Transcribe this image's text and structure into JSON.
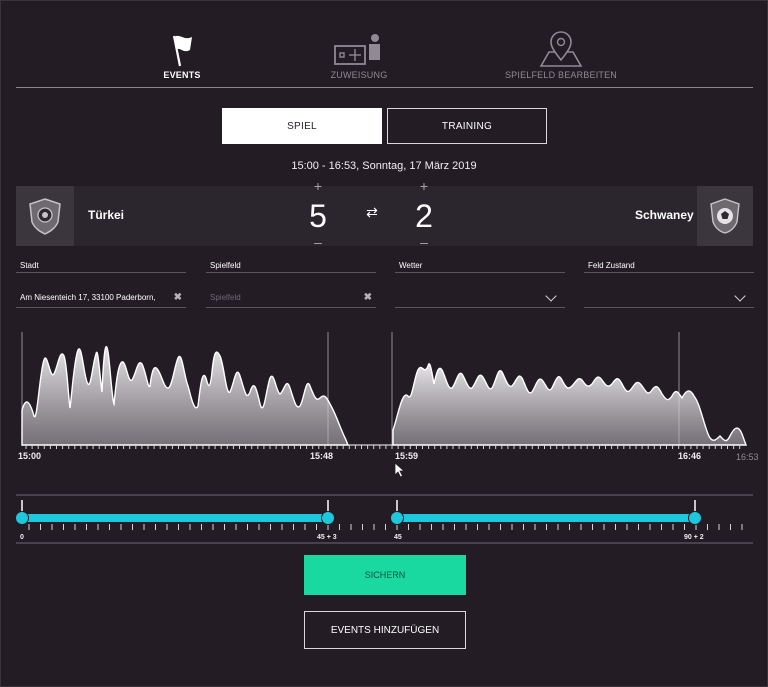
{
  "nav": [
    {
      "label": "EVENTS",
      "icon": "flag-icon",
      "active": true
    },
    {
      "label": "ZUWEISUNG",
      "icon": "assignment-icon",
      "active": false
    },
    {
      "label": "SPIELFELD BEARBEITEN",
      "icon": "map-pin-icon",
      "active": false
    }
  ],
  "toggle": {
    "spiel": "SPIEL",
    "training": "TRAINING",
    "selected": "SPIEL"
  },
  "datetime": "15:00 - 16:53, Sonntag, 17 März 2019",
  "score": {
    "home_team": "Türkei",
    "away_team": "Schwaney",
    "home_score": "5",
    "away_score": "2",
    "plus": "+",
    "minus": "–",
    "swap": "⇄"
  },
  "fields": {
    "stadt": {
      "label": "Stadt",
      "value": "Am Niesenteich 17, 33100 Paderborn,"
    },
    "spielfeld": {
      "label": "Spielfeld",
      "placeholder": "Spielfeld"
    },
    "wetter": {
      "label": "Wetter",
      "value": ""
    },
    "feld_zustand": {
      "label": "Feld Zustand",
      "value": ""
    }
  },
  "timeline": {
    "first_half": {
      "start": "15:00",
      "end": "15:48"
    },
    "second_half": {
      "start": "15:59",
      "end": "16:46"
    },
    "match_end": "16:53"
  },
  "sliders": {
    "first_half": {
      "min_label": "0",
      "max_label": "45 + 3"
    },
    "second_half": {
      "min_label": "45",
      "max_label": "90 + 2"
    }
  },
  "colors": {
    "accent": "#19d9a0",
    "slider": "#1ec8dc",
    "background": "#231c24"
  },
  "buttons": {
    "save": "SICHERN",
    "add_events": "EVENTS HINZUFÜGEN"
  }
}
